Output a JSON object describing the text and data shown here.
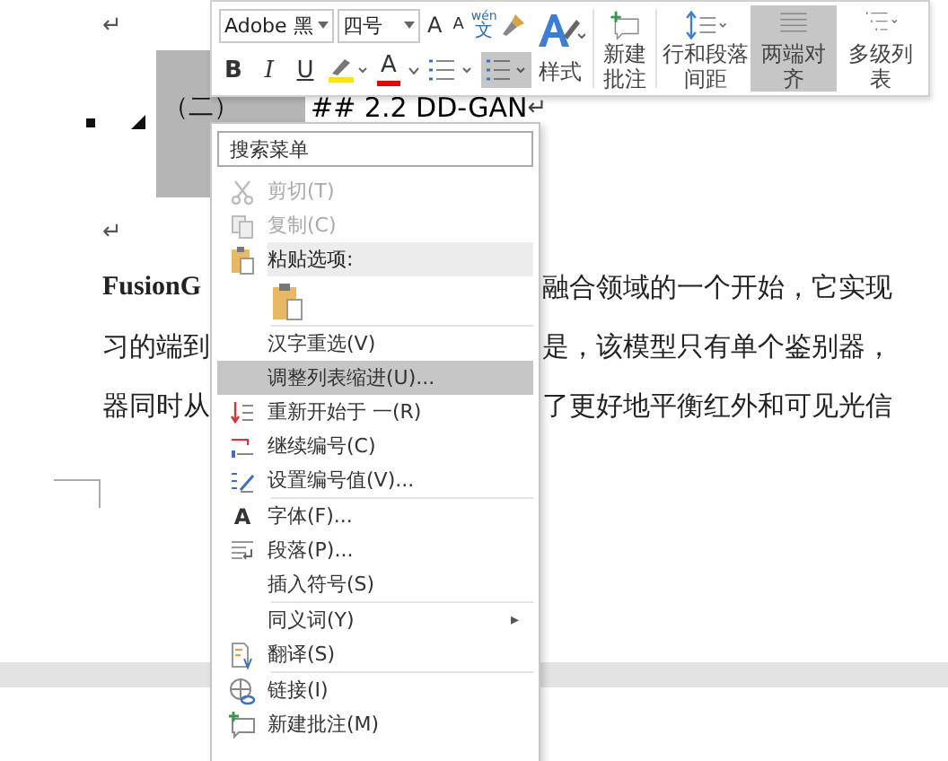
{
  "document": {
    "top_mark": "↵",
    "heading": {
      "number": "（二）",
      "text": "## 2.2 DD-GAN",
      "end_mark": "↵"
    },
    "mid_mark": "↵",
    "paragraph_lines": [
      {
        "left": "FusionG",
        "right": "融合领域的一个开始，它实现"
      },
      {
        "left": "习的端到",
        "right": "是，该模型只有单个鉴别器，"
      },
      {
        "left": "器同时从",
        "right": "了更好地平衡红外和可见光信"
      }
    ]
  },
  "mini_toolbar": {
    "font": "Adobe 黑",
    "size": "四号",
    "grow": "A",
    "shrink": "A",
    "phonetic_top": "wén",
    "phonetic_bottom": "文",
    "format_buttons": [
      {
        "label": "B",
        "kind": "bold"
      },
      {
        "label": "I",
        "kind": "italic"
      },
      {
        "label": "U",
        "kind": "underline"
      }
    ],
    "font_color": "A",
    "numbering_selected": true,
    "big_buttons": [
      {
        "label": "样式",
        "selected": false
      },
      {
        "label": "新建批注",
        "selected": false
      },
      {
        "label": "行和段落间距",
        "selected": false
      },
      {
        "label": "两端对齐",
        "selected": true
      },
      {
        "label": "多级列表",
        "selected": false
      }
    ]
  },
  "context_menu": {
    "search_placeholder": "搜索菜单",
    "items": [
      {
        "kind": "item",
        "label": "剪切(T)",
        "disabled": true,
        "selected": false
      },
      {
        "kind": "item",
        "label": "复制(C)",
        "disabled": true,
        "selected": false
      },
      {
        "kind": "header",
        "label": "粘贴选项:"
      },
      {
        "kind": "paste-icons"
      },
      {
        "kind": "separator"
      },
      {
        "kind": "item",
        "label": "汉字重选(V)",
        "disabled": false,
        "selected": false
      },
      {
        "kind": "item",
        "label": "调整列表缩进(U)...",
        "disabled": false,
        "selected": true
      },
      {
        "kind": "item",
        "label": "重新开始于 一(R)",
        "disabled": false,
        "selected": false
      },
      {
        "kind": "item",
        "label": "继续编号(C)",
        "disabled": false,
        "selected": false
      },
      {
        "kind": "item",
        "label": "设置编号值(V)...",
        "disabled": false,
        "selected": false
      },
      {
        "kind": "separator"
      },
      {
        "kind": "item",
        "label": "字体(F)...",
        "icon_text": "A",
        "disabled": false,
        "selected": false
      },
      {
        "kind": "item",
        "label": "段落(P)...",
        "disabled": false,
        "selected": false
      },
      {
        "kind": "item",
        "label": "插入符号(S)",
        "disabled": false,
        "selected": false
      },
      {
        "kind": "separator"
      },
      {
        "kind": "item",
        "label": "同义词(Y)",
        "submenu": "▸",
        "disabled": false,
        "selected": false
      },
      {
        "kind": "item",
        "label": "翻译(S)",
        "disabled": false,
        "selected": false
      },
      {
        "kind": "separator"
      },
      {
        "kind": "item",
        "label": "链接(I)",
        "disabled": false,
        "selected": false
      },
      {
        "kind": "item",
        "label": "新建批注(M)",
        "disabled": false,
        "selected": false
      }
    ]
  }
}
